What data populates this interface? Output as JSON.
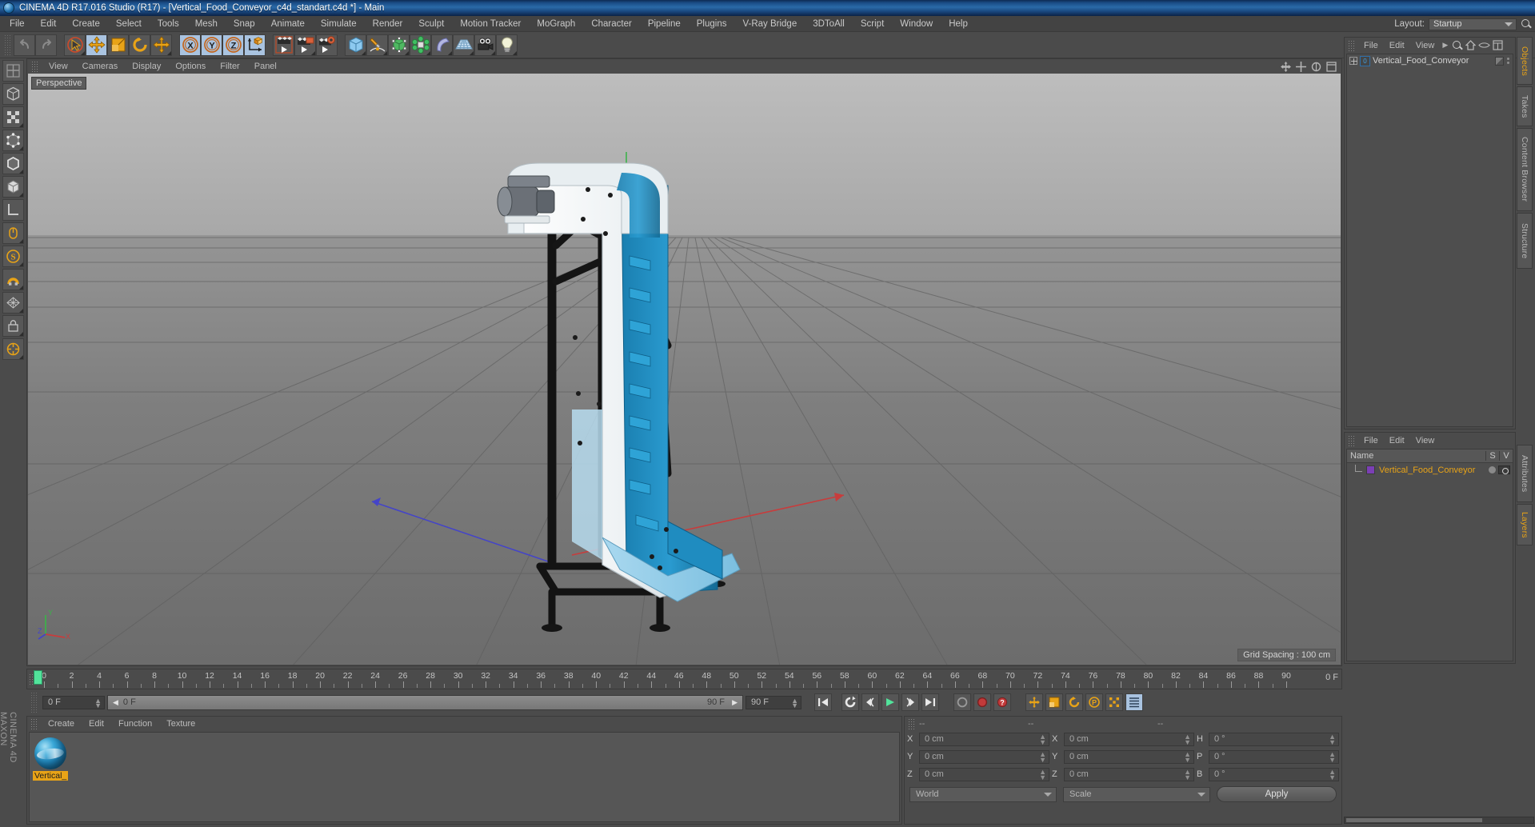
{
  "window": {
    "title": "CINEMA 4D R17.016 Studio (R17) - [Vertical_Food_Conveyor_c4d_standart.c4d *] - Main",
    "app_icon": "cinema4d-icon"
  },
  "menubar": {
    "items": [
      "File",
      "Edit",
      "Create",
      "Select",
      "Tools",
      "Mesh",
      "Snap",
      "Animate",
      "Simulate",
      "Render",
      "Sculpt",
      "Motion Tracker",
      "MoGraph",
      "Character",
      "Pipeline",
      "Plugins",
      "V-Ray Bridge",
      "3DToAll",
      "Script",
      "Window",
      "Help"
    ],
    "layout_label": "Layout:",
    "layout_value": "Startup",
    "search_icon": "search-icon"
  },
  "toolbar": {
    "groups": [
      {
        "name": "history",
        "buttons": [
          {
            "icon": "undo-icon",
            "highlight": false,
            "corner": false
          },
          {
            "icon": "redo-icon",
            "highlight": false,
            "corner": false
          }
        ]
      },
      {
        "name": "transform",
        "buttons": [
          {
            "icon": "select-cursor-icon",
            "highlight": false,
            "corner": true
          },
          {
            "icon": "move-icon",
            "highlight": true,
            "corner": false
          },
          {
            "icon": "scale-icon",
            "highlight": false,
            "corner": false
          },
          {
            "icon": "rotate-icon",
            "highlight": false,
            "corner": false
          },
          {
            "icon": "move-alt-icon",
            "highlight": false,
            "corner": true
          }
        ]
      },
      {
        "name": "axis-lock",
        "buttons": [
          {
            "icon": "x-axis-icon",
            "highlight": true,
            "corner": false
          },
          {
            "icon": "y-axis-icon",
            "highlight": true,
            "corner": false
          },
          {
            "icon": "z-axis-icon",
            "highlight": true,
            "corner": false
          },
          {
            "icon": "world-coordinate-icon",
            "highlight": true,
            "corner": false
          }
        ]
      },
      {
        "name": "render",
        "buttons": [
          {
            "icon": "render-view-icon",
            "highlight": false,
            "corner": false
          },
          {
            "icon": "render-to-picture-viewer-icon",
            "highlight": false,
            "corner": true
          },
          {
            "icon": "render-settings-icon",
            "highlight": false,
            "corner": false
          }
        ]
      },
      {
        "name": "objects",
        "buttons": [
          {
            "icon": "cube-primitive-icon",
            "highlight": false,
            "corner": true
          },
          {
            "icon": "spline-pen-icon",
            "highlight": false,
            "corner": true
          },
          {
            "icon": "nurbs-generator-icon",
            "highlight": false,
            "corner": true
          },
          {
            "icon": "array-cloner-icon",
            "highlight": false,
            "corner": true
          },
          {
            "icon": "deformer-bend-icon",
            "highlight": false,
            "corner": true
          },
          {
            "icon": "floor-environment-icon",
            "highlight": false,
            "corner": true
          },
          {
            "icon": "camera-icon",
            "highlight": false,
            "corner": true
          },
          {
            "icon": "light-icon",
            "highlight": false,
            "corner": true
          }
        ]
      }
    ]
  },
  "left_tools": [
    "make-editable-icon",
    "model-mode-icon",
    "texture-mode-icon",
    "points-mode-icon",
    "edges-mode-icon",
    "polygons-mode-icon",
    "object-axis-icon",
    "viewport-solo-icon",
    "enable-axis-icon",
    "snap-magnet-icon",
    "workplane-icon",
    "lock-workplane-icon",
    "quantize-icon"
  ],
  "left_brand": {
    "line1": "MAXON",
    "line2": "CINEMA 4D"
  },
  "viewport": {
    "menu": [
      "View",
      "Cameras",
      "Display",
      "Options",
      "Filter",
      "Panel"
    ],
    "view_label": "Perspective",
    "grid_spacing": "Grid Spacing : 100 cm",
    "axis_gizmo": {
      "x": "X",
      "y": "Y",
      "z": "Z"
    },
    "corner_icons": [
      "move-view-icon",
      "scale-view-icon",
      "rotate-view-icon",
      "maximize-view-icon"
    ],
    "scene_description": "Vertical food conveyor 3D model, white and blue, black steel frame"
  },
  "timeline": {
    "start_frame": "0 F",
    "end_frame": "90 F",
    "current_frame": "0 F",
    "preview_end": "90 F",
    "ticks": [
      0,
      2,
      4,
      6,
      8,
      10,
      12,
      14,
      16,
      18,
      20,
      22,
      24,
      26,
      28,
      30,
      32,
      34,
      36,
      38,
      40,
      42,
      44,
      46,
      48,
      50,
      52,
      54,
      56,
      58,
      60,
      62,
      64,
      66,
      68,
      70,
      72,
      74,
      76,
      78,
      80,
      82,
      84,
      86,
      88,
      90
    ],
    "range_end_label": "0 F"
  },
  "transport": {
    "buttons": [
      {
        "icon": "go-to-start-icon"
      },
      {
        "icon": "play-reverse-loop-icon"
      },
      {
        "icon": "step-back-icon"
      },
      {
        "icon": "play-icon"
      },
      {
        "icon": "step-forward-icon"
      },
      {
        "icon": "go-to-end-icon"
      },
      {
        "icon": "record-active-objects-icon"
      },
      {
        "icon": "autokeying-icon"
      },
      {
        "icon": "keyframe-selection-icon"
      },
      {
        "icon": "position-key-icon"
      },
      {
        "icon": "scale-key-icon"
      },
      {
        "icon": "rotation-key-icon"
      },
      {
        "icon": "parameter-key-icon"
      },
      {
        "icon": "point-level-animation-icon"
      },
      {
        "icon": "timeline-settings-icon"
      }
    ]
  },
  "material_manager": {
    "menu": [
      "Create",
      "Edit",
      "Function",
      "Texture"
    ],
    "materials": [
      {
        "name": "Vertical_",
        "preview": "blue-white-material-sphere"
      }
    ]
  },
  "coordinates": {
    "header_cols": [
      "--",
      "--",
      "--"
    ],
    "position": {
      "label_x": "X",
      "label_y": "Y",
      "label_z": "Z",
      "x": "0 cm",
      "y": "0 cm",
      "z": "0 cm"
    },
    "size": {
      "label_x": "X",
      "label_y": "Y",
      "label_z": "Z",
      "x": "0 cm",
      "y": "0 cm",
      "z": "0 cm"
    },
    "rotation": {
      "label_h": "H",
      "label_p": "P",
      "label_b": "B",
      "h": "0 °",
      "p": "0 °",
      "b": "0 °"
    },
    "system": "World",
    "mode": "Scale",
    "apply": "Apply"
  },
  "object_manager": {
    "menu": [
      "File",
      "Edit",
      "View"
    ],
    "overflow_icon": "chevron-right-icon",
    "header_icons": [
      "search-icon",
      "home-icon",
      "eye-icon",
      "fit-icon"
    ],
    "items": [
      {
        "name": "Vertical_Food_Conveyor",
        "badge": "0",
        "type": "null-object"
      }
    ]
  },
  "layer_manager": {
    "menu": [
      "File",
      "Edit",
      "View"
    ],
    "columns": {
      "name": "Name",
      "s": "S",
      "v": "V"
    },
    "rows": [
      {
        "name": "Vertical_Food_Conveyor",
        "color": "#7b3fb5"
      }
    ]
  },
  "right_tabs_top": [
    "Objects",
    "Takes",
    "Content Browser",
    "Structure"
  ],
  "right_tabs_bottom": [
    "Attributes",
    "Layers"
  ],
  "colors": {
    "accent_orange": "#e8a317",
    "panel_bg": "#4b4b4b",
    "field_bg": "#474747",
    "highlight_blue": "#a9c3e0",
    "model_blue": "#1e87b8",
    "model_white": "#eef2f4",
    "playhead_green": "#52e39b"
  }
}
